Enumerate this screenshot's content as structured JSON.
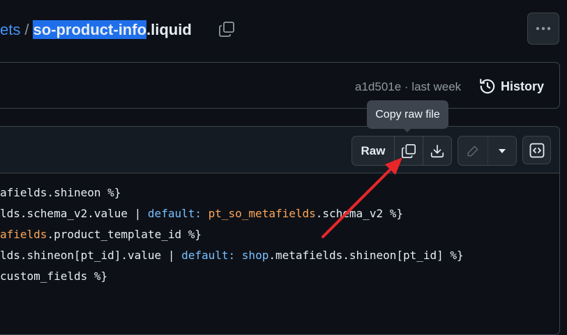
{
  "breadcrumb": {
    "parent": "ets",
    "separator": "/",
    "file_selected": "so-product-info",
    "file_ext": ".liquid"
  },
  "header": {
    "more_label": "..."
  },
  "commit": {
    "hash": "a1d501e · last week",
    "history_label": "History"
  },
  "toolbar": {
    "tooltip": "Copy raw file",
    "raw_label": "Raw"
  },
  "code": {
    "lines": [
      [
        {
          "t": "afields.shineon %}",
          "c": ""
        }
      ],
      [
        {
          "t": "lds.schema_v2.value | ",
          "c": ""
        },
        {
          "t": "default:",
          "c": "blue"
        },
        {
          "t": " ",
          "c": ""
        },
        {
          "t": "pt_so_metafields",
          "c": "orange"
        },
        {
          "t": ".schema_v2 %}",
          "c": ""
        }
      ],
      [
        {
          "t": "afields",
          "c": "orange"
        },
        {
          "t": ".product_template_id %}",
          "c": ""
        }
      ],
      [
        {
          "t": "lds.shineon[pt_id].value | ",
          "c": ""
        },
        {
          "t": "default:",
          "c": "blue"
        },
        {
          "t": " ",
          "c": ""
        },
        {
          "t": "shop",
          "c": "blue"
        },
        {
          "t": ".metafields.shineon[pt_id] %}",
          "c": ""
        }
      ],
      [
        {
          "t": "custom_fields %}",
          "c": ""
        }
      ]
    ]
  },
  "colors": {
    "background": "#0d1117",
    "accent_link": "#4493f8",
    "annotation_arrow": "#e8262a"
  }
}
